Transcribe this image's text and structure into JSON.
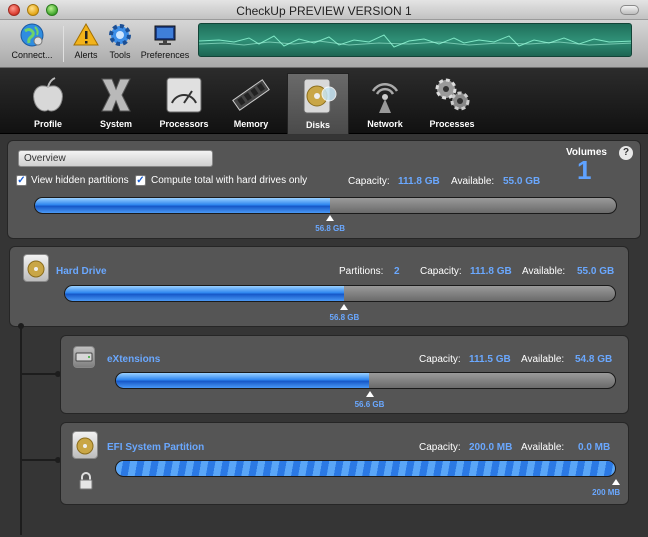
{
  "window": {
    "title": "CheckUp PREVIEW VERSION 1"
  },
  "toolbar": {
    "items": [
      {
        "label": "Connect..."
      },
      {
        "label": "Alerts"
      },
      {
        "label": "Tools"
      },
      {
        "label": "Preferences"
      }
    ]
  },
  "tabs": [
    {
      "label": "Profile"
    },
    {
      "label": "System"
    },
    {
      "label": "Processors"
    },
    {
      "label": "Memory"
    },
    {
      "label": "Disks",
      "active": true
    },
    {
      "label": "Network"
    },
    {
      "label": "Processes"
    }
  ],
  "overview": {
    "tab_label": "Overview",
    "volumes_label": "Volumes",
    "volumes_count": "1",
    "help": "?",
    "view_hidden": {
      "label": "View hidden partitions",
      "checked": true
    },
    "compute_total": {
      "label": "Compute total with hard drives only",
      "checked": true
    },
    "capacity_label": "Capacity:",
    "capacity_value": "111.8 GB",
    "available_label": "Available:",
    "available_value": "55.0 GB",
    "used_fraction": 0.508,
    "marker_label": "56.8 GB"
  },
  "drives": [
    {
      "name": "Hard Drive",
      "partitions_label": "Partitions:",
      "partitions_value": "2",
      "capacity_label": "Capacity:",
      "capacity_value": "111.8 GB",
      "available_label": "Available:",
      "available_value": "55.0 GB",
      "used_fraction": 0.508,
      "marker_label": "56.8 GB"
    },
    {
      "name": "eXtensions",
      "capacity_label": "Capacity:",
      "capacity_value": "111.5 GB",
      "available_label": "Available:",
      "available_value": "54.8 GB",
      "used_fraction": 0.508,
      "marker_label": "56.6 GB"
    },
    {
      "name": "EFI System Partition",
      "capacity_label": "Capacity:",
      "capacity_value": "200.0 MB",
      "available_label": "Available:",
      "available_value": "0.0 MB",
      "used_fraction": 1.0,
      "marker_label": "200 MB",
      "locked": true
    }
  ],
  "colors": {
    "accent": "#6aa8ff",
    "bar_fill": "#2f86ef",
    "panel": "#555555"
  }
}
